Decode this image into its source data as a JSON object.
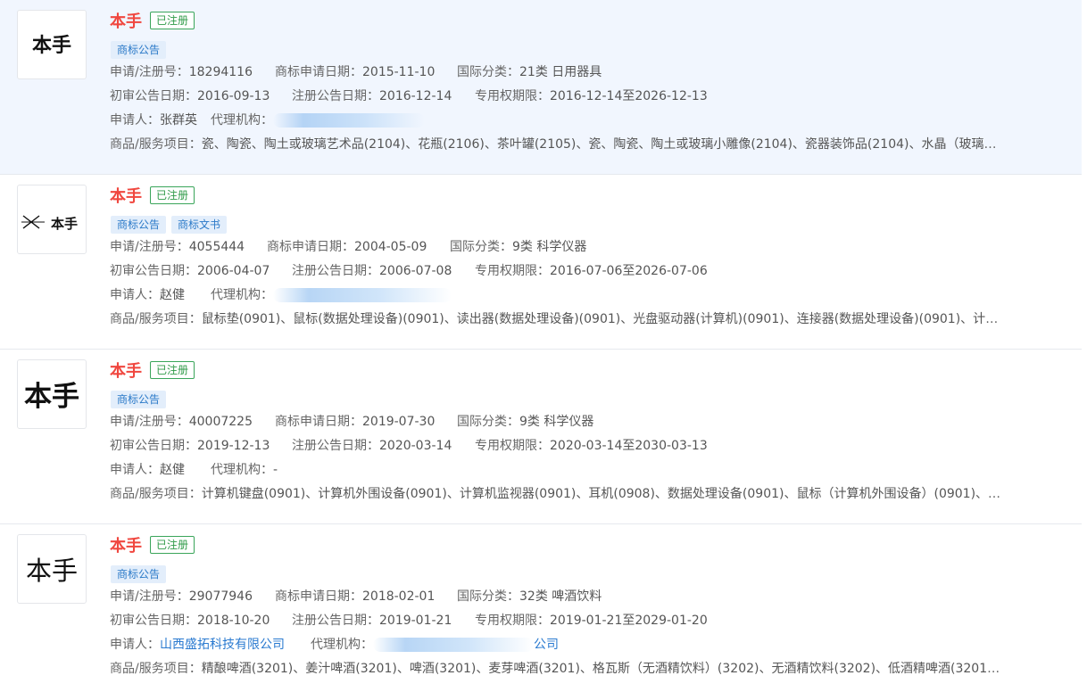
{
  "items": [
    {
      "name": "本手",
      "status": "已注册",
      "tags": [
        "商标公告"
      ],
      "reg_label": "申请/注册号：",
      "reg_no": "18294116",
      "apply_label": "商标申请日期：",
      "apply_date": "2015-11-10",
      "class_label": "国际分类：",
      "class_value": "21类 日用器具",
      "prelim_label": "初审公告日期：",
      "prelim_date": "2016-09-13",
      "regpub_label": "注册公告日期：",
      "regpub_date": "2016-12-14",
      "term_label": "专用权期限：",
      "term_value": "2016-12-14至2026-12-13",
      "applicant_label": "申请人：",
      "applicant": "张群英",
      "agent_label": "代理机构：",
      "agent": "",
      "goods_label": "商品/服务项目：",
      "goods": "瓷、陶瓷、陶土或玻璃艺术品(2104)、花瓶(2106)、茶叶罐(2105)、瓷、陶瓷、陶土或玻璃小雕像(2104)、瓷器装饰品(2104)、水晶（玻璃制品..."
    },
    {
      "name": "本手",
      "status": "已注册",
      "tags": [
        "商标公告",
        "商标文书"
      ],
      "reg_label": "申请/注册号：",
      "reg_no": "4055444",
      "apply_label": "商标申请日期：",
      "apply_date": "2004-05-09",
      "class_label": "国际分类：",
      "class_value": "9类 科学仪器",
      "prelim_label": "初审公告日期：",
      "prelim_date": "2006-04-07",
      "regpub_label": "注册公告日期：",
      "regpub_date": "2006-07-08",
      "term_label": "专用权期限：",
      "term_value": "2016-07-06至2026-07-06",
      "applicant_label": "申请人：",
      "applicant": "赵健",
      "agent_label": "代理机构：",
      "agent": "",
      "goods_label": "商品/服务项目：",
      "goods": "鼠标垫(0901)、鼠标(数据处理设备)(0901)、读出器(数据处理设备)(0901)、光盘驱动器(计算机)(0901)、连接器(数据处理设备)(0901)、计算机..."
    },
    {
      "name": "本手",
      "status": "已注册",
      "tags": [
        "商标公告"
      ],
      "reg_label": "申请/注册号：",
      "reg_no": "40007225",
      "apply_label": "商标申请日期：",
      "apply_date": "2019-07-30",
      "class_label": "国际分类：",
      "class_value": "9类 科学仪器",
      "prelim_label": "初审公告日期：",
      "prelim_date": "2019-12-13",
      "regpub_label": "注册公告日期：",
      "regpub_date": "2020-03-14",
      "term_label": "专用权期限：",
      "term_value": "2020-03-14至2030-03-13",
      "applicant_label": "申请人：",
      "applicant": "赵健",
      "agent_label": "代理机构：",
      "agent": "-",
      "goods_label": "商品/服务项目：",
      "goods": "计算机键盘(0901)、计算机外围设备(0901)、计算机监视器(0901)、耳机(0908)、数据处理设备(0901)、鼠标（计算机外围设备）(0901)、手机..."
    },
    {
      "name": "本手",
      "status": "已注册",
      "tags": [
        "商标公告"
      ],
      "reg_label": "申请/注册号：",
      "reg_no": "29077946",
      "apply_label": "商标申请日期：",
      "apply_date": "2018-02-01",
      "class_label": "国际分类：",
      "class_value": "32类 啤酒饮料",
      "prelim_label": "初审公告日期：",
      "prelim_date": "2018-10-20",
      "regpub_label": "注册公告日期：",
      "regpub_date": "2019-01-21",
      "term_label": "专用权期限：",
      "term_value": "2019-01-21至2029-01-20",
      "applicant_label": "申请人：",
      "applicant": "山西盛拓科技有限公司",
      "agent_label": "代理机构：",
      "agent": "公司",
      "goods_label": "商品/服务项目：",
      "goods": "精酿啤酒(3201)、姜汁啤酒(3201)、啤酒(3201)、麦芽啤酒(3201)、格瓦斯（无酒精饮料）(3202)、无酒精饮料(3202)、低酒精啤酒(3201)、大..."
    }
  ],
  "logos": [
    {
      "text": "本手",
      "style": "brush"
    },
    {
      "text": "本手",
      "style": "stylized-x"
    },
    {
      "text": "本手",
      "style": "bold"
    },
    {
      "text": "本手",
      "style": "serif"
    }
  ]
}
